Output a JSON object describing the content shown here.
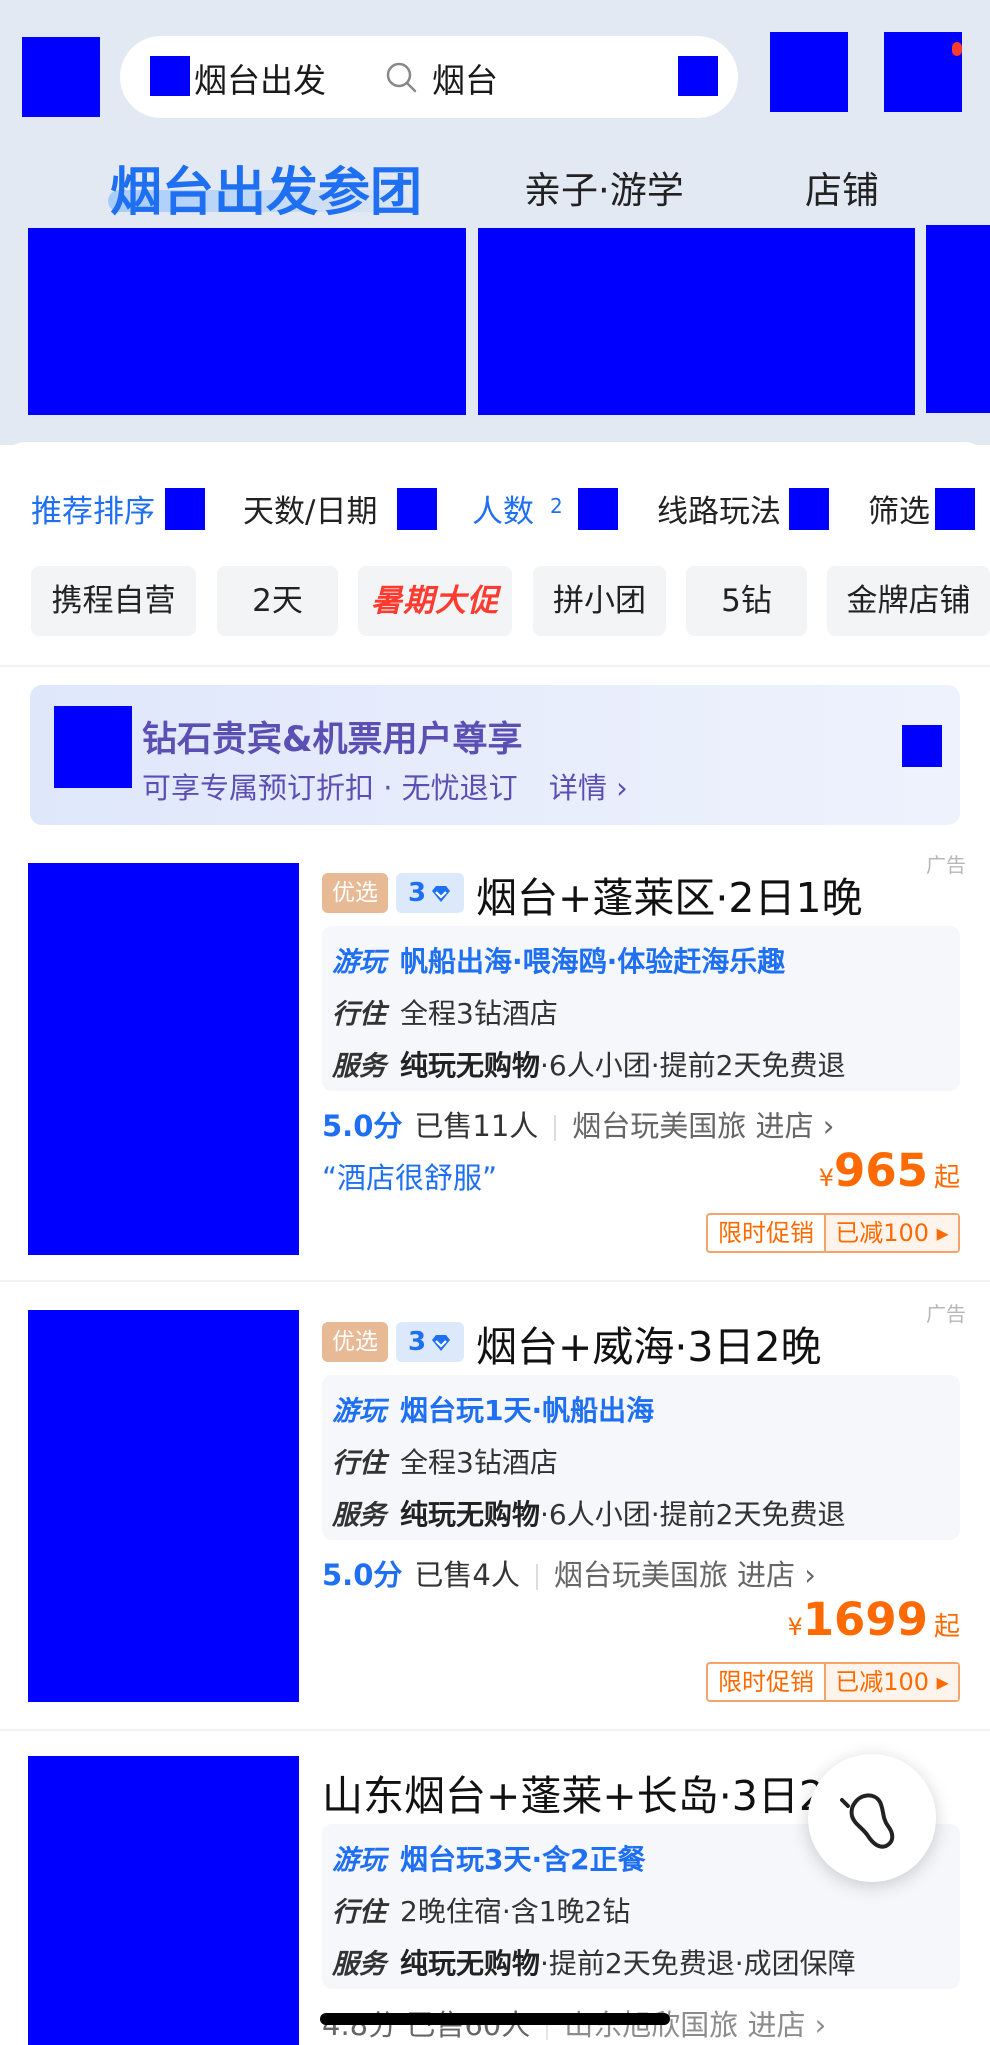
{
  "header": {
    "search_city": "烟台出发",
    "search_query": "烟台"
  },
  "tabs": [
    {
      "label": "烟台出发参团",
      "active": true
    },
    {
      "label": "亲子·游学",
      "active": false
    },
    {
      "label": "店铺",
      "active": false
    }
  ],
  "filters": {
    "sort": "推荐排序",
    "days_date": "天数/日期",
    "people": "人数",
    "people_count": "2",
    "route": "线路玩法",
    "filter": "筛选"
  },
  "chips": [
    "携程自营",
    "2天",
    "暑期大促",
    "拼小团",
    "5钻",
    "金牌店铺"
  ],
  "member_banner": {
    "title": "钻石贵宾&机票用户尊享",
    "subtitle": "可享专属预订折扣 · 无忧退订",
    "details": "详情 ›"
  },
  "products": [
    {
      "ad": "广告",
      "tag_selected": "优选",
      "diamond": "3",
      "title": "烟台+蓬莱区·2日1晚",
      "play_key": "游玩",
      "play": "帆船出海·喂海鸥·体验赶海乐趣",
      "stay_key": "行住",
      "stay": "全程3钻酒店",
      "service_key": "服务",
      "service_strong": "纯玩无购物",
      "service": "·6人小团·提前2天免费退",
      "score": "5.0分",
      "sold": "已售11人",
      "store": "烟台玩美国旅 进店 ›",
      "quote": "“酒店很舒服”",
      "currency": "¥",
      "price": "965",
      "price_suffix": "起",
      "promo_label": "限时促销",
      "promo_discount": "已减100 ▸"
    },
    {
      "ad": "广告",
      "tag_selected": "优选",
      "diamond": "3",
      "title": "烟台+威海·3日2晚",
      "play_key": "游玩",
      "play": "烟台玩1天·帆船出海",
      "stay_key": "行住",
      "stay": "全程3钻酒店",
      "service_key": "服务",
      "service_strong": "纯玩无购物",
      "service": "·6人小团·提前2天免费退",
      "score": "5.0分",
      "sold": "已售4人",
      "store": "烟台玩美国旅 进店 ›",
      "currency": "¥",
      "price": "1699",
      "price_suffix": "起",
      "promo_label": "限时促销",
      "promo_discount": "已减100 ▸"
    },
    {
      "title": "山东烟台+蓬莱+长岛·3日2",
      "play_key": "游玩",
      "play": "烟台玩3天·含2正餐",
      "stay_key": "行住",
      "stay": "2晚住宿·含1晚2钻",
      "service_key": "服务",
      "service_strong": "纯玩无购物",
      "service": "·提前2天免费退·成团保障",
      "meta_partial": "4.8分 已售60人",
      "store": "山东旭欣国旅 进店 ›"
    }
  ]
}
